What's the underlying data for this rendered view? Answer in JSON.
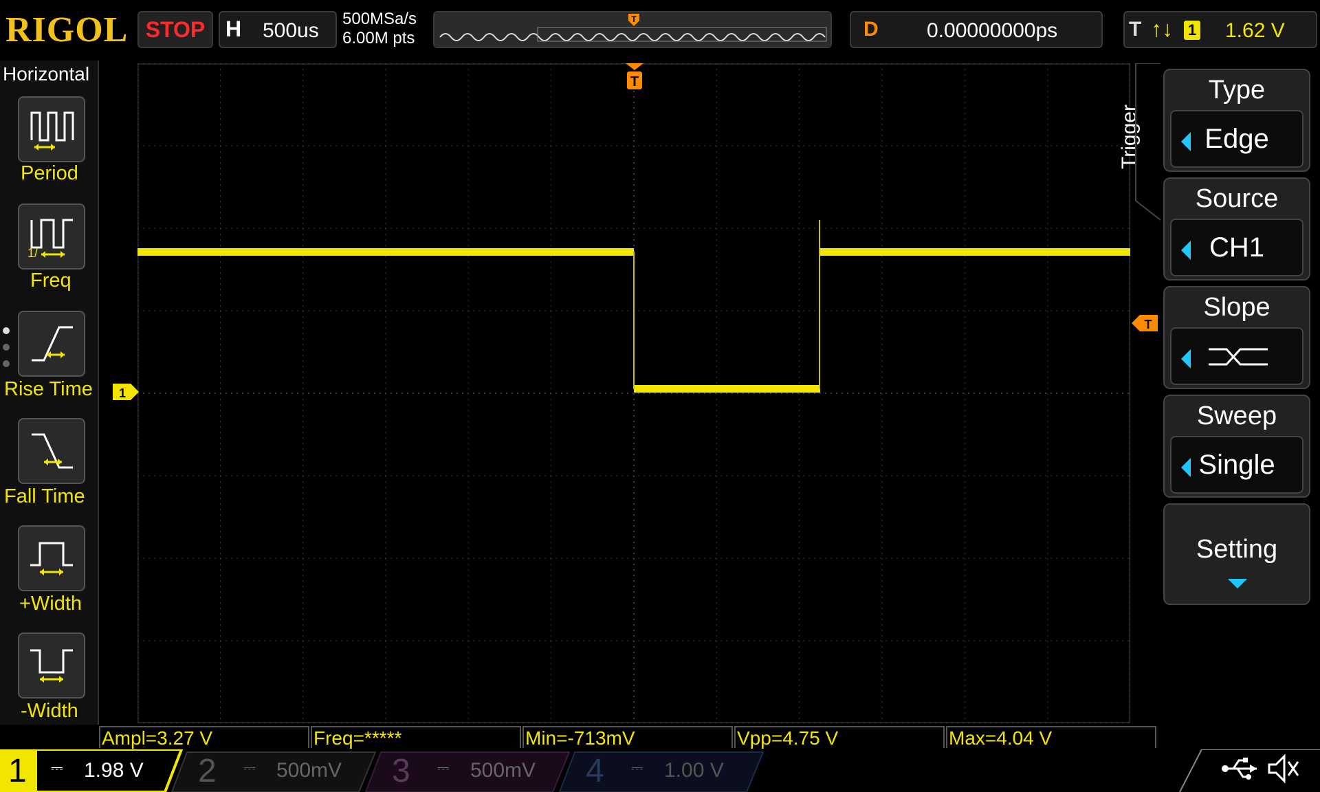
{
  "brand": "RIGOL",
  "run_state": "STOP",
  "horizontal": {
    "label": "H",
    "timebase": "500us"
  },
  "acquisition": {
    "sample_rate": "500MSa/s",
    "mem_depth": "6.00M pts"
  },
  "delay": {
    "label": "D",
    "value": "0.00000000ps"
  },
  "trigger_status": {
    "label": "T",
    "slope_symbol": "↑↓",
    "source_badge": "1",
    "level": "1.62 V"
  },
  "left_menu": {
    "title": "Horizontal",
    "items": [
      {
        "label": "Period",
        "icon": "period-icon"
      },
      {
        "label": "Freq",
        "icon": "freq-icon"
      },
      {
        "label": "Rise Time",
        "icon": "rise-time-icon"
      },
      {
        "label": "Fall Time",
        "icon": "fall-time-icon"
      },
      {
        "label": "+Width",
        "icon": "positive-width-icon"
      },
      {
        "label": "-Width",
        "icon": "negative-width-icon"
      }
    ]
  },
  "right_menu": {
    "tab": "Trigger",
    "items": [
      {
        "label": "Type",
        "value": "Edge"
      },
      {
        "label": "Source",
        "value": "CH1"
      },
      {
        "label": "Slope",
        "value": ""
      },
      {
        "label": "Sweep",
        "value": "Single"
      },
      {
        "label": "Setting"
      }
    ]
  },
  "markers": {
    "trigger_top": "T",
    "trigger_level": "T",
    "ch1_ground": "1"
  },
  "measurements": [
    "Ampl=3.27 V",
    "Freq=*****",
    "Min=-713mV",
    "Vpp=4.75 V",
    "Max=4.04 V"
  ],
  "channels": [
    {
      "num": "1",
      "coupling": "⎓",
      "scale": "1.98 V",
      "active": true,
      "color": "#f2e600"
    },
    {
      "num": "2",
      "coupling": "⎓",
      "scale": "500mV",
      "active": false,
      "color": "#5ad0ff"
    },
    {
      "num": "3",
      "coupling": "⎓",
      "scale": "500mV",
      "active": false,
      "color": "#e03ce0"
    },
    {
      "num": "4",
      "coupling": "⎓",
      "scale": "1.00 V",
      "active": false,
      "color": "#3a6cff"
    }
  ],
  "colors": {
    "ch1": "#f2e600",
    "trigger": "#ff8c00",
    "menu_accent": "#1ec8ff"
  }
}
